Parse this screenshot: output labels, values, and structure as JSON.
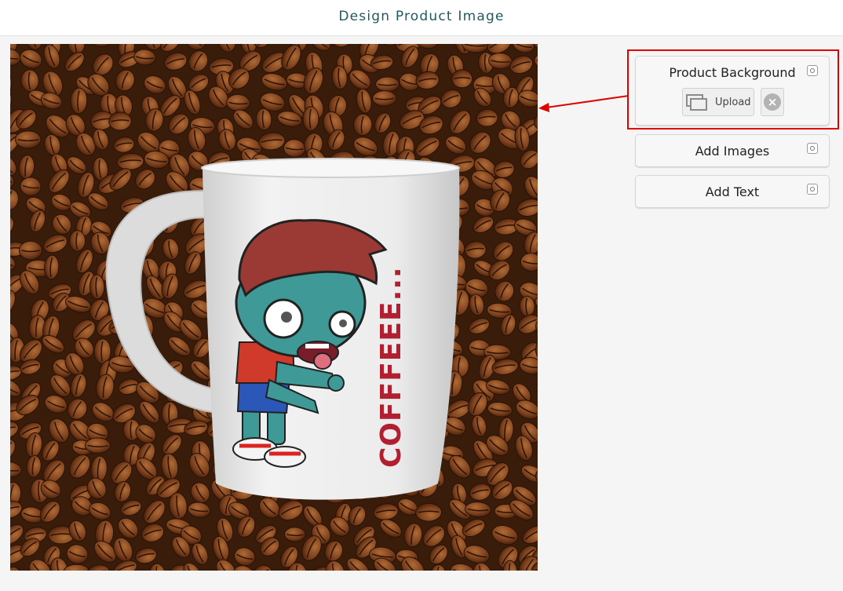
{
  "header": {
    "title": "Design Product Image"
  },
  "canvas": {
    "mug_text": "COFFFEEE...",
    "colors": {
      "bean_dark": "#3a1c0b",
      "bean": "#7a3f1c",
      "mug": "#e9e9e9",
      "zombie_skin": "#3f9a97",
      "text_red": "#b02030"
    }
  },
  "panels": {
    "background": {
      "title": "Product Background",
      "upload_label": "Upload",
      "toggle_icon": "collapse-icon",
      "remove_icon": "close-circle-icon"
    },
    "images": {
      "title": "Add Images",
      "toggle_icon": "collapse-icon"
    },
    "text": {
      "title": "Add Text",
      "toggle_icon": "collapse-icon"
    }
  },
  "annotation": {
    "highlight_color": "#e00000"
  }
}
